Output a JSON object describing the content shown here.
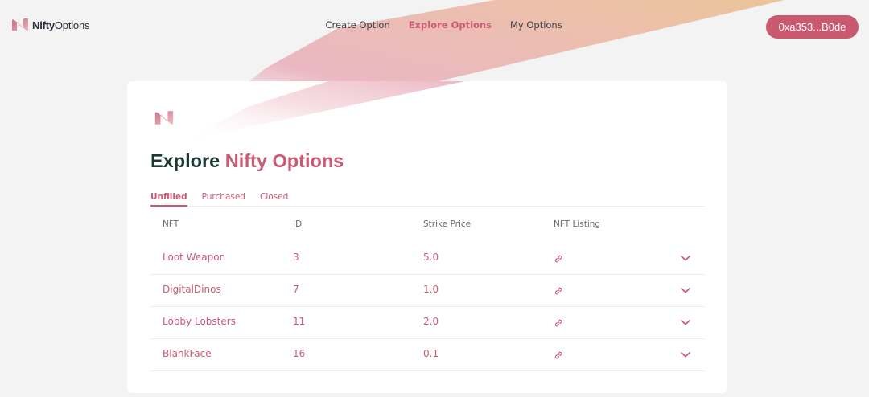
{
  "header": {
    "logo": {
      "bold": "Nifty",
      "light": "Options"
    },
    "nav": [
      {
        "label": "Create Option",
        "active": false
      },
      {
        "label": "Explore Options",
        "active": true
      },
      {
        "label": "My Options",
        "active": false
      }
    ],
    "wallet_label": "0xa353...B0de"
  },
  "main": {
    "title_prefix": "Explore ",
    "title_accent": "Nifty Options",
    "tabs": [
      {
        "label": "Unfilled",
        "active": true
      },
      {
        "label": "Purchased",
        "active": false
      },
      {
        "label": "Closed",
        "active": false
      }
    ],
    "columns": [
      "NFT",
      "ID",
      "Strike Price",
      "NFT Listing"
    ],
    "rows": [
      {
        "nft": "Loot Weapon",
        "id": "3",
        "strike": "5.0",
        "listing_icon": "link-icon",
        "expand_icon": "chevron-down-icon"
      },
      {
        "nft": "DigitalDinos",
        "id": "7",
        "strike": "1.0",
        "listing_icon": "link-icon",
        "expand_icon": "chevron-down-icon"
      },
      {
        "nft": "Lobby Lobsters",
        "id": "11",
        "strike": "2.0",
        "listing_icon": "link-icon",
        "expand_icon": "chevron-down-icon"
      },
      {
        "nft": "BlankFace",
        "id": "16",
        "strike": "0.1",
        "listing_icon": "link-icon",
        "expand_icon": "chevron-down-icon"
      }
    ]
  },
  "colors": {
    "accent": "#cc5a74",
    "wallet_bg": "#c8596f",
    "title_dark": "#1c3a33",
    "page_bg": "#f3f3f4",
    "gradient_pink": "#e8a3b1",
    "gradient_gold": "#eac08f"
  }
}
